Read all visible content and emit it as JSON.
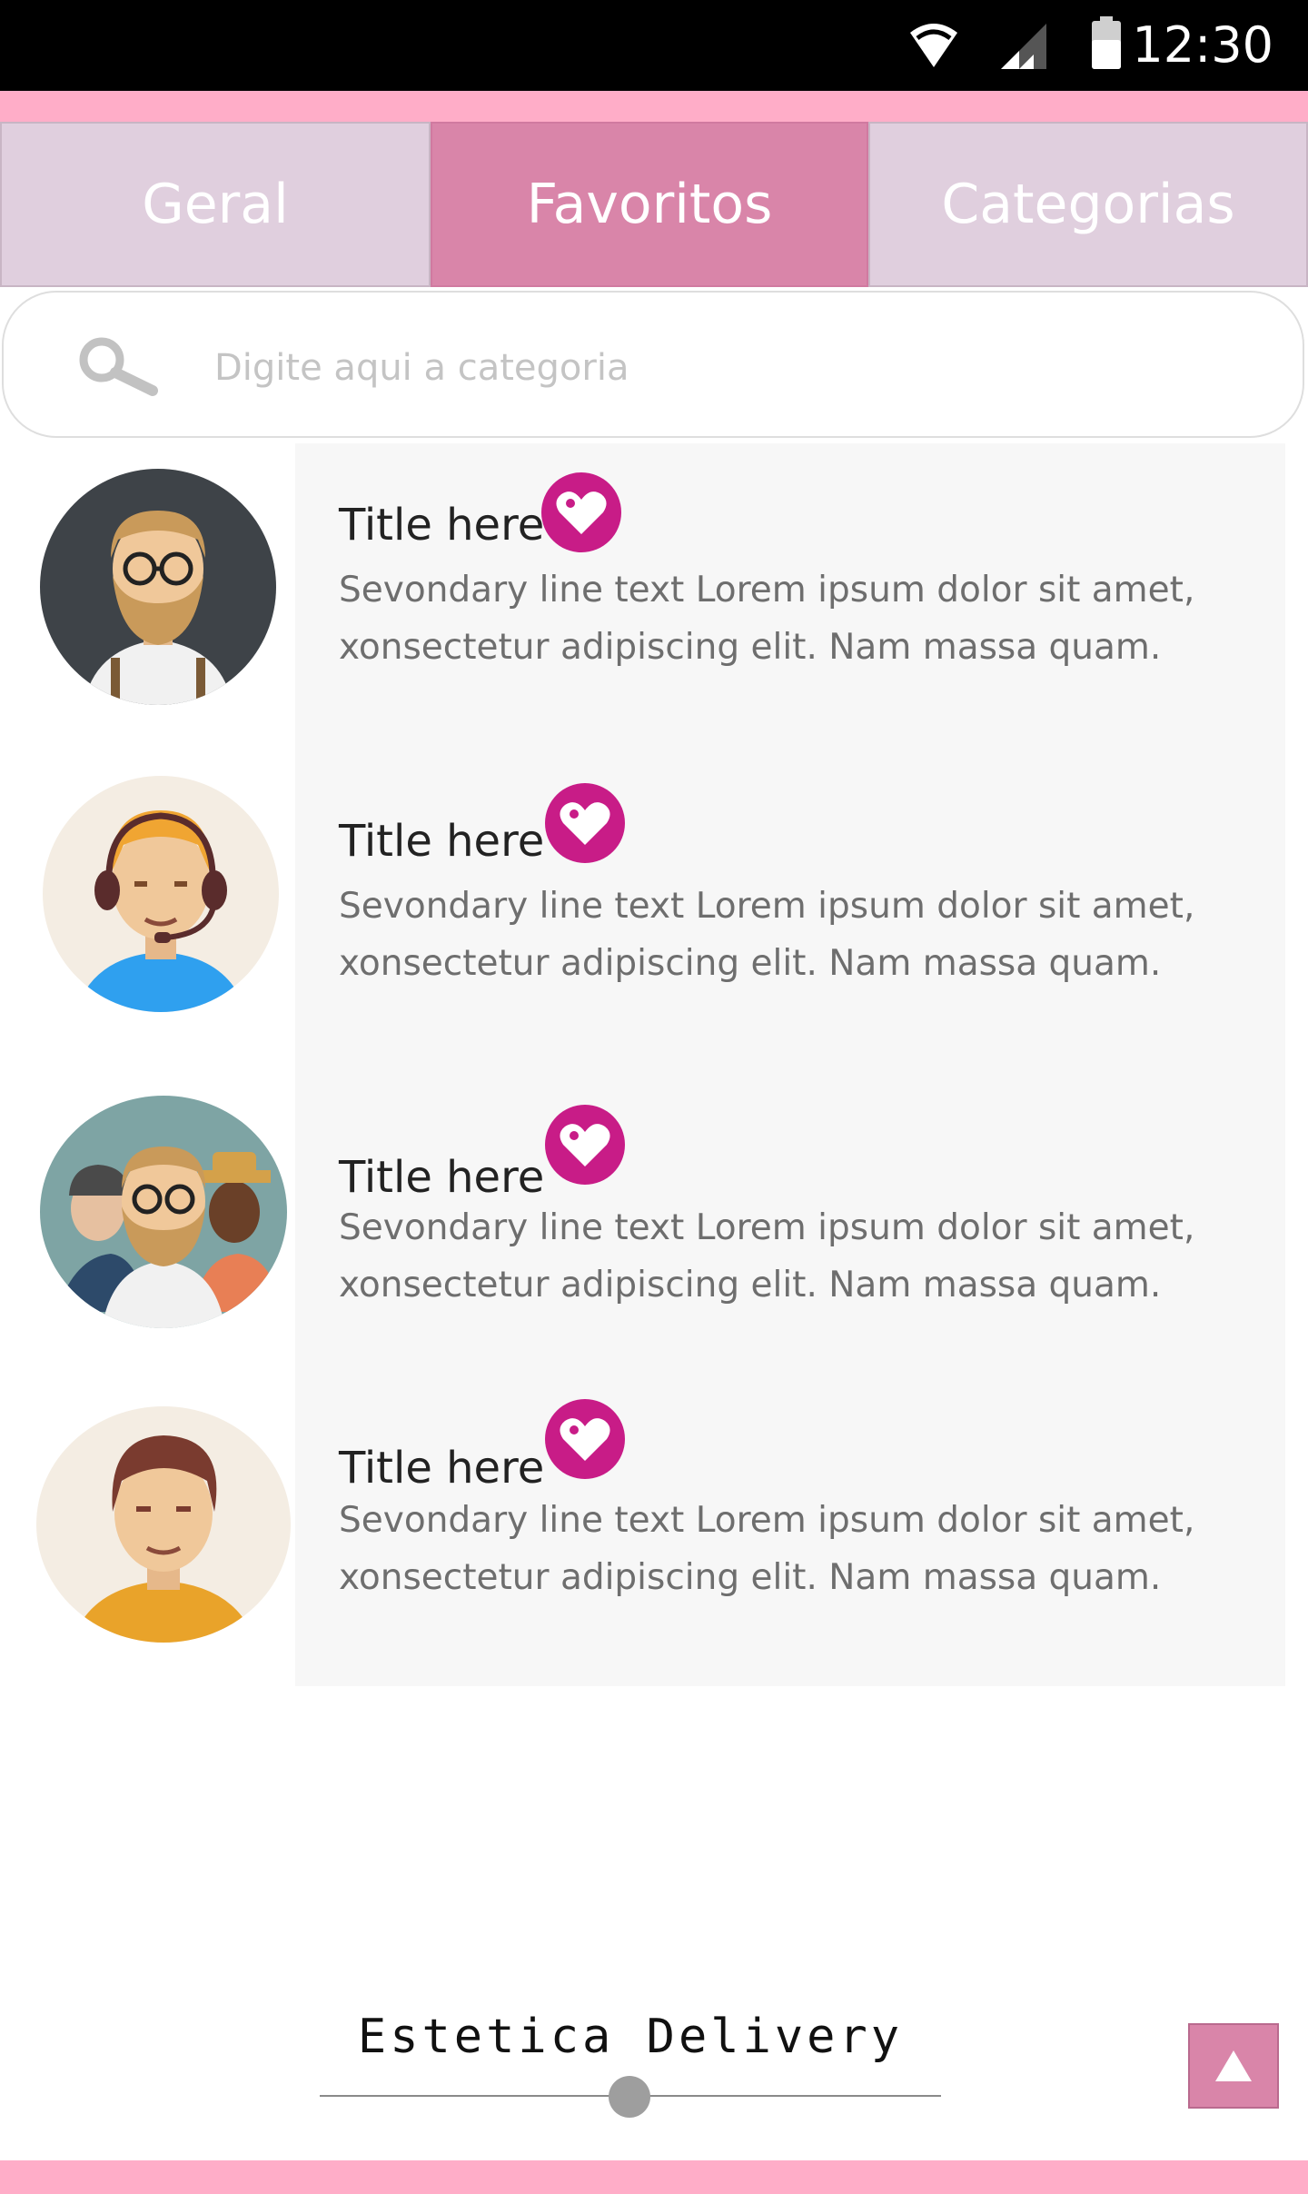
{
  "status_bar": {
    "time": "12:30",
    "icons": [
      "wifi-icon",
      "signal-icon",
      "battery-icon"
    ]
  },
  "tabs": [
    {
      "label": "Geral",
      "active": false
    },
    {
      "label": "Favoritos",
      "active": true
    },
    {
      "label": "Categorias",
      "active": false
    }
  ],
  "search": {
    "placeholder": "Digite aqui a categoria",
    "value": "",
    "icon": "search-icon"
  },
  "list": {
    "items": [
      {
        "title": "Title here",
        "secondary_line1": "Sevondary line text Lorem ipsum dolor sit amet,",
        "secondary_line2": "xonsectetur adipiscing elit. Nam massa quam.",
        "avatar": "bearded-man-avatar",
        "favorite_icon": "heart-icon"
      },
      {
        "title": "Title here",
        "secondary_line1": "Sevondary line text Lorem ipsum dolor sit amet,",
        "secondary_line2": "xonsectetur adipiscing elit. Nam massa quam.",
        "avatar": "headset-agent-avatar",
        "favorite_icon": "heart-icon"
      },
      {
        "title": "Title here",
        "secondary_line1": "Sevondary line text Lorem ipsum dolor sit amet,",
        "secondary_line2": "xonsectetur adipiscing elit. Nam massa quam.",
        "avatar": "group-avatar",
        "favorite_icon": "heart-icon"
      },
      {
        "title": "Title here",
        "secondary_line1": "Sevondary line text Lorem ipsum dolor sit amet,",
        "secondary_line2": "xonsectetur adipiscing elit. Nam massa quam.",
        "avatar": "young-man-avatar",
        "favorite_icon": "heart-icon"
      }
    ]
  },
  "footer": {
    "title": "Estetica Delivery",
    "scroll_top_icon": "arrow-up-icon"
  },
  "colors": {
    "accent_pink": "#ffadc8",
    "tab_active": "#d985a9",
    "tab_inactive": "#e0cfde",
    "heart": "#c81c87"
  }
}
